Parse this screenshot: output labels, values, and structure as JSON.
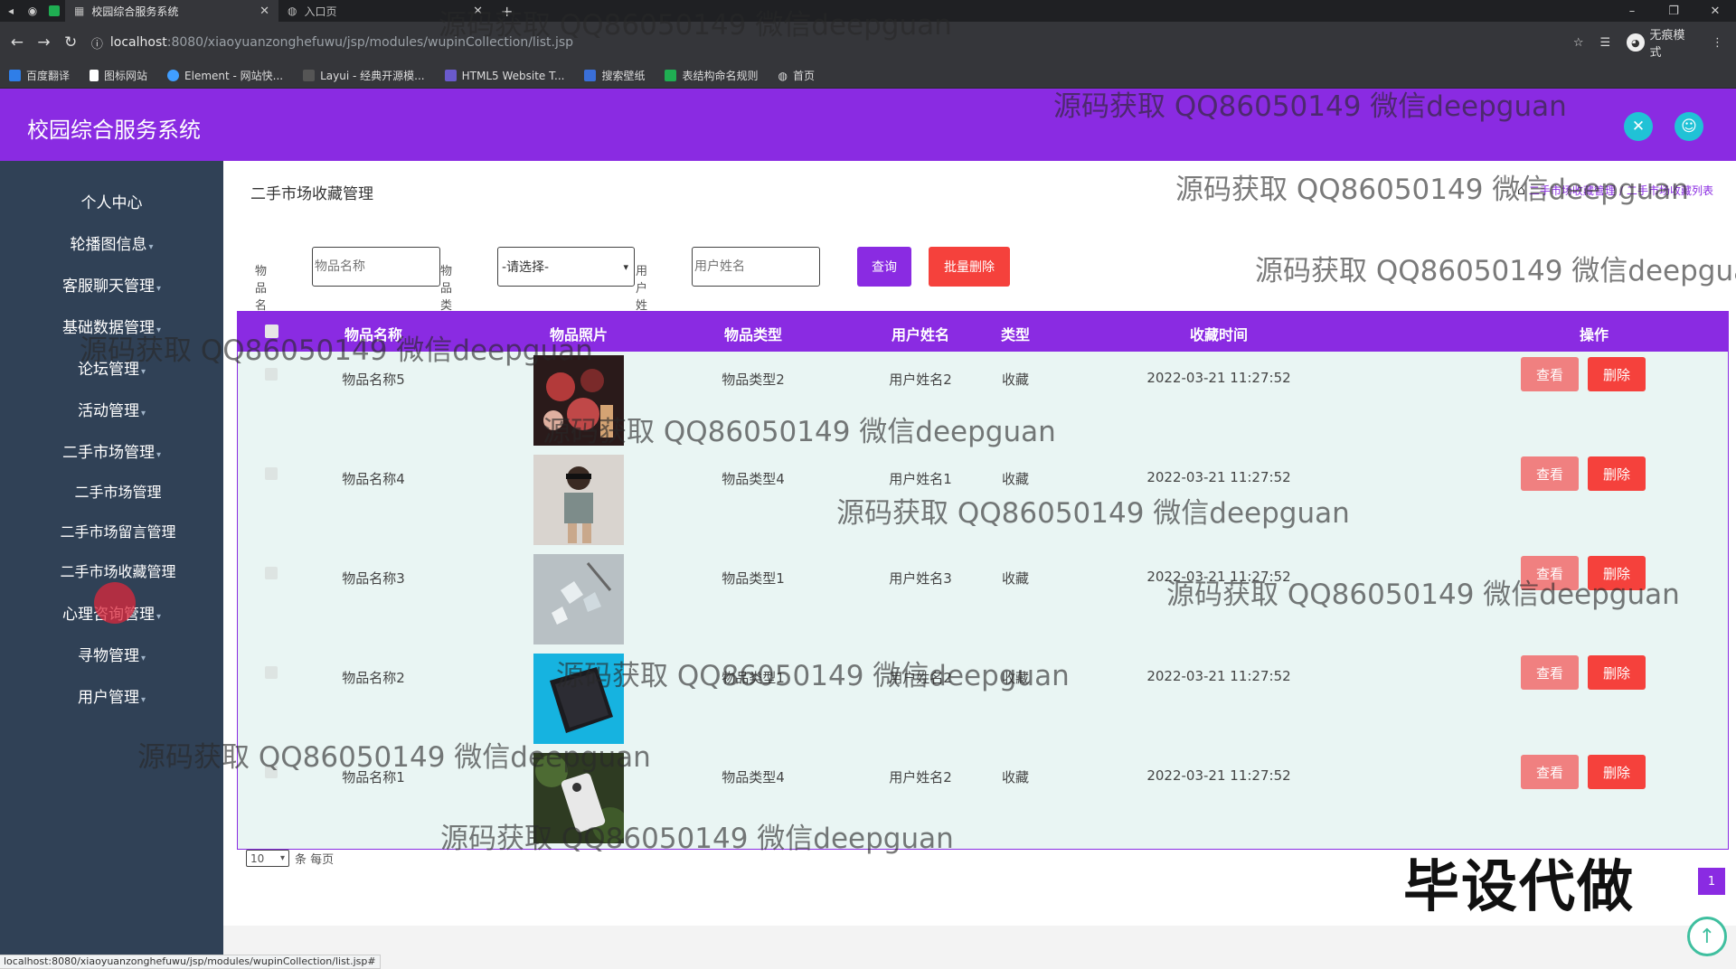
{
  "browser": {
    "tabs": [
      {
        "title": "校园综合服务系统",
        "active": true
      },
      {
        "title": "入口页",
        "active": false
      }
    ],
    "url_host": "localhost",
    "url_rest": ":8080/xiaoyuanzonghefuwu/jsp/modules/wupinCollection/list.jsp",
    "guest_label": "无痕模式",
    "bookmarks": [
      "百度翻译",
      "图标网站",
      "Element - 网站快...",
      "Layui - 经典开源模...",
      "HTML5 Website T...",
      "搜索壁纸",
      "表结构命名规则",
      "首页"
    ],
    "status_url": "localhost:8080/xiaoyuanzonghefuwu/jsp/modules/wupinCollection/list.jsp#"
  },
  "header": {
    "title": "校园综合服务系统"
  },
  "sidebar": {
    "items": [
      "个人中心",
      "轮播图信息",
      "客服聊天管理",
      "基础数据管理",
      "论坛管理",
      "活动管理",
      "二手市场管理",
      "二手市场管理",
      "二手市场留言管理",
      "二手市场收藏管理",
      "心理咨询管理",
      "寻物管理",
      "用户管理"
    ]
  },
  "main": {
    "page_title": "二手市场收藏管理",
    "breadcrumb": [
      "二手市场收藏管理",
      "二手市场收藏列表"
    ],
    "search": {
      "name_label": "物品名称",
      "name_placeholder": "物品名称",
      "type_label": "物品类型",
      "type_selected": "-请选择-",
      "user_label": "用户姓名",
      "user_placeholder": "用户姓名",
      "query_label": "查询",
      "batch_delete_label": "批量删除"
    },
    "table": {
      "headers": [
        "物品名称",
        "物品照片",
        "物品类型",
        "用户姓名",
        "类型",
        "收藏时间",
        "操作"
      ],
      "rows": [
        {
          "name": "物品名称5",
          "type": "物品类型2",
          "user": "用户姓名2",
          "kind": "收藏",
          "time": "2022-03-21 11:27:52",
          "photo": "cosmetics"
        },
        {
          "name": "物品名称4",
          "type": "物品类型4",
          "user": "用户姓名1",
          "kind": "收藏",
          "time": "2022-03-21 11:27:52",
          "photo": "person"
        },
        {
          "name": "物品名称3",
          "type": "物品类型1",
          "user": "用户姓名3",
          "kind": "收藏",
          "time": "2022-03-21 11:27:52",
          "photo": "crystals"
        },
        {
          "name": "物品名称2",
          "type": "物品类型1",
          "user": "用户姓名2",
          "kind": "收藏",
          "time": "2022-03-21 11:27:52",
          "photo": "tablet"
        },
        {
          "name": "物品名称1",
          "type": "物品类型4",
          "user": "用户姓名2",
          "kind": "收藏",
          "time": "2022-03-21 11:27:52",
          "photo": "phone"
        }
      ],
      "view_label": "查看",
      "delete_label": "删除"
    },
    "pager": {
      "page_size": "10",
      "per_page_text": "条 每页",
      "current_page": "1"
    },
    "stamp_text": "毕设代做"
  },
  "watermark_text": "源码获取 QQ86050149 微信deepguan",
  "colors": {
    "accent": "#8a2be2",
    "sidebar": "#304156",
    "danger": "#f5413c",
    "view": "#f08080",
    "header_icon": "#20c2d6"
  }
}
